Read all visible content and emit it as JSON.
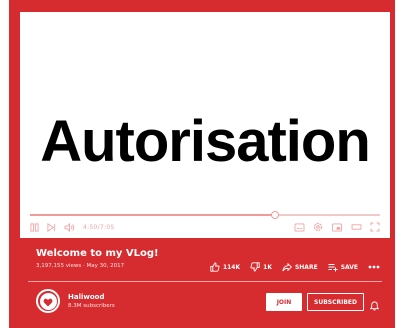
{
  "player": {
    "title_overlay": "Autorisation",
    "time": "4:50/7:05",
    "progress": 0.7
  },
  "video": {
    "title": "Welcome to my VLog!",
    "meta": "3,197,155 views · May 30, 2017"
  },
  "actions": {
    "like_count": "114K",
    "dislike_count": "1K",
    "share_label": "SHARE",
    "save_label": "SAVE"
  },
  "channel": {
    "name": "Haliwood",
    "subscribers": "8.3M subscribers"
  },
  "buttons": {
    "join_label": "JOIN",
    "subscribed_label": "SUBSCRIBED"
  },
  "colors": {
    "brand": "#d62b2f",
    "video_background": "#ffffff",
    "text": "#ffffff"
  },
  "icons": [
    "play-icon",
    "skip-icon",
    "volume-icon",
    "captions-icon",
    "settings-icon",
    "miniplayer-icon",
    "theater-icon",
    "fullscreen-icon",
    "like-icon",
    "dislike-icon",
    "share-icon",
    "save-icon",
    "more-icon",
    "heart-icon",
    "bell-icon"
  ]
}
